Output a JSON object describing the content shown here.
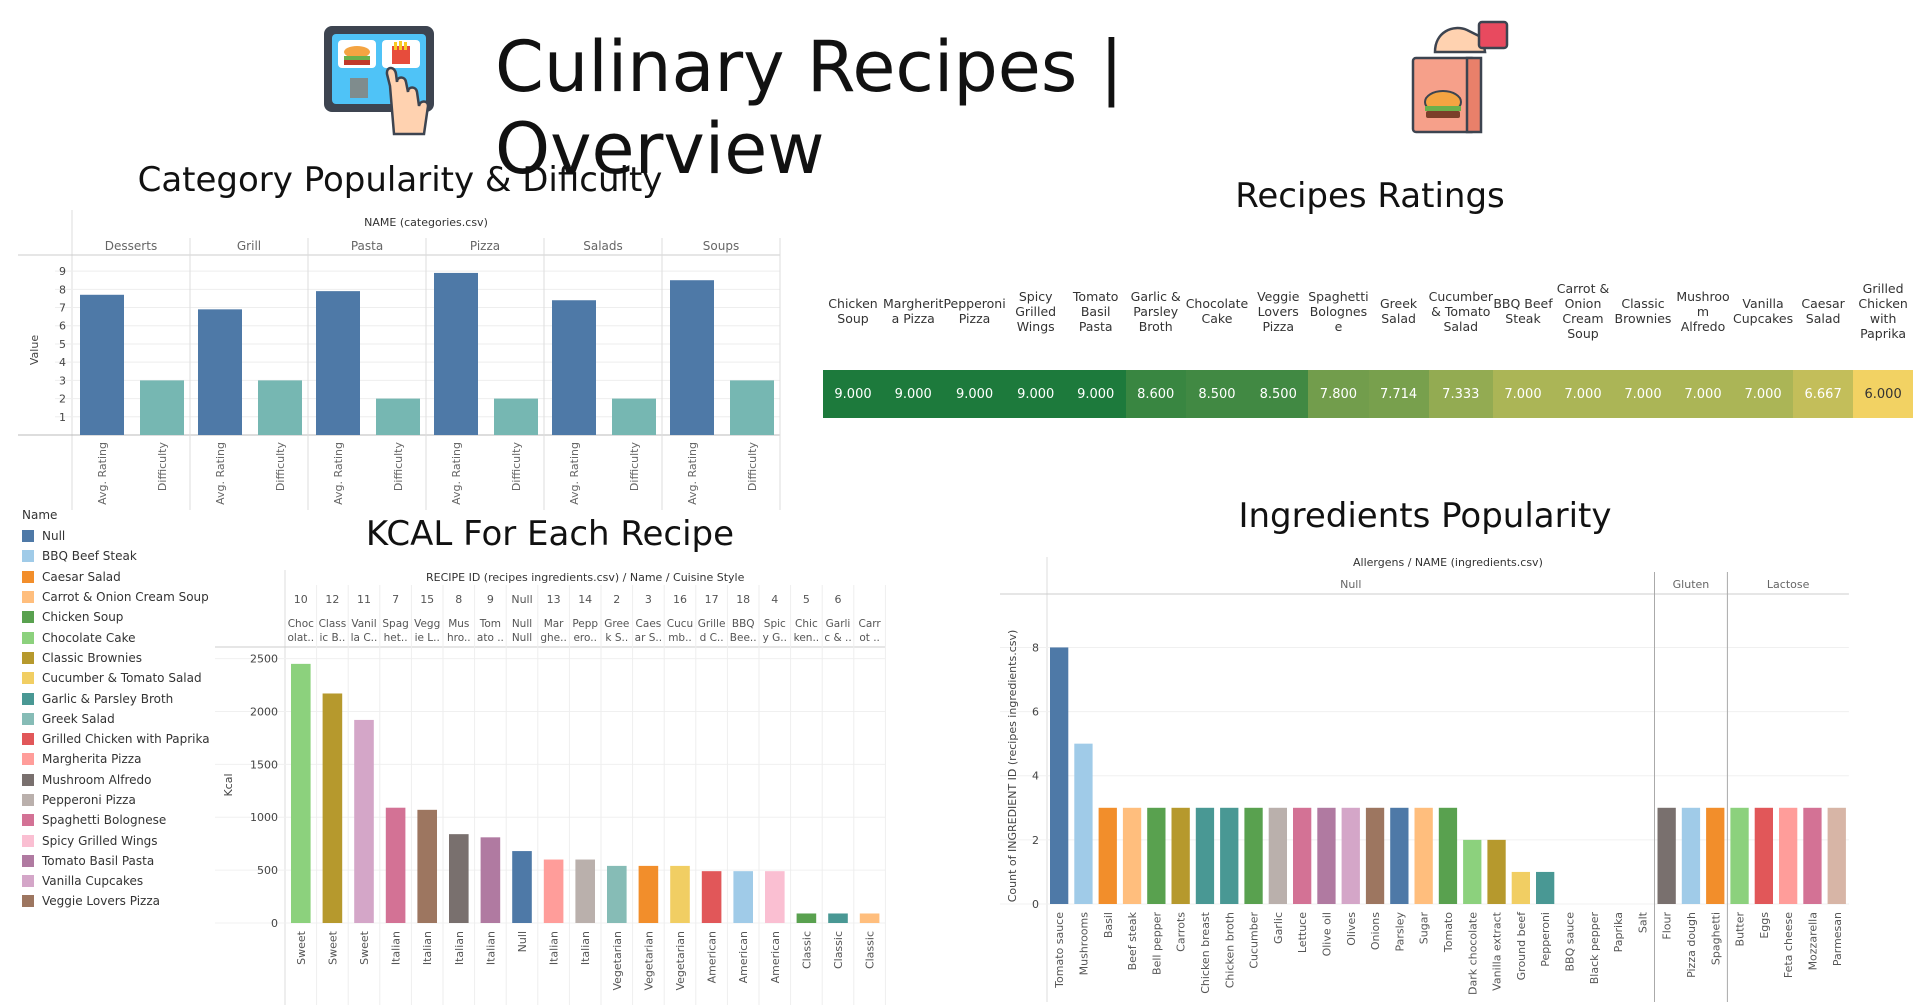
{
  "header": {
    "title": "Culinary Recipes | Overview",
    "left_icon": "tablet-food-ordering-icon",
    "right_icon": "takeaway-burger-bag-icon"
  },
  "sections": {
    "category": "Category Popularity & Dificulty",
    "ratings": "Recipes Ratings",
    "kcal": "KCAL For Each Recipe",
    "ingredients": "Ingredients Popularity"
  },
  "colors": {
    "rating_bar": "#4e79a7",
    "difficulty_bar": "#76b7b2",
    "heat_dark": "#1d7a3c",
    "heat_light": "#f2d263"
  },
  "legend": {
    "title": "Name",
    "items": [
      {
        "label": "Null",
        "color": "#4e79a7"
      },
      {
        "label": "BBQ Beef Steak",
        "color": "#a0cbe8"
      },
      {
        "label": "Caesar Salad",
        "color": "#f28e2b"
      },
      {
        "label": "Carrot & Onion Cream Soup",
        "color": "#ffbe7d"
      },
      {
        "label": "Chicken Soup",
        "color": "#59a14f"
      },
      {
        "label": "Chocolate Cake",
        "color": "#8cd17d"
      },
      {
        "label": "Classic Brownies",
        "color": "#b6992d"
      },
      {
        "label": "Cucumber & Tomato Salad",
        "color": "#f1ce63"
      },
      {
        "label": "Garlic & Parsley Broth",
        "color": "#499894"
      },
      {
        "label": "Greek Salad",
        "color": "#86bcb6"
      },
      {
        "label": "Grilled Chicken with Paprika",
        "color": "#e15759"
      },
      {
        "label": "Margherita Pizza",
        "color": "#ff9d9a"
      },
      {
        "label": "Mushroom Alfredo",
        "color": "#79706e"
      },
      {
        "label": "Pepperoni Pizza",
        "color": "#bab0ac"
      },
      {
        "label": "Spaghetti Bolognese",
        "color": "#d37295"
      },
      {
        "label": "Spicy Grilled Wings",
        "color": "#fabfd2"
      },
      {
        "label": "Tomato Basil Pasta",
        "color": "#b07aa1"
      },
      {
        "label": "Vanilla Cupcakes",
        "color": "#d4a6c8"
      },
      {
        "label": "Veggie Lovers Pizza",
        "color": "#9d7660"
      }
    ]
  },
  "chart_data": [
    {
      "type": "bar",
      "title": "Category Popularity & Dificulty",
      "header": "NAME (categories.csv)",
      "categories": [
        "Desserts",
        "Grill",
        "Pasta",
        "Pizza",
        "Salads",
        "Soups"
      ],
      "measures": [
        "Avg. Rating",
        "Difficulty"
      ],
      "series": [
        {
          "name": "Avg. Rating",
          "values": [
            7.7,
            6.9,
            7.9,
            8.9,
            7.4,
            8.5
          ]
        },
        {
          "name": "Difficulty",
          "values": [
            3,
            3,
            2,
            2,
            2,
            3
          ]
        }
      ],
      "ylabel": "Value",
      "yticks": [
        1,
        2,
        3,
        4,
        5,
        6,
        7,
        8,
        9
      ],
      "ylim": [
        0,
        9.5
      ]
    },
    {
      "type": "heatmap",
      "title": "Recipes Ratings",
      "columns": [
        "Chicken Soup",
        "Margherita Pizza",
        "Pepperoni Pizza",
        "Spicy Grilled Wings",
        "Tomato Basil Pasta",
        "Garlic & Parsley Broth",
        "Chocolate Cake",
        "Veggie Lovers Pizza",
        "Spaghetti Bolognese",
        "Greek Salad",
        "Cucumber & Tomato Salad",
        "BBQ Beef Steak",
        "Carrot & Onion Cream Soup",
        "Classic Brownies",
        "Mushroom Alfredo",
        "Vanilla Cupcakes",
        "Caesar Salad",
        "Grilled Chicken with Paprika"
      ],
      "header_lines": [
        [
          "Chicken",
          "Soup"
        ],
        [
          "Margherit",
          "a Pizza"
        ],
        [
          "Pepperoni",
          "Pizza"
        ],
        [
          "Spicy",
          "Grilled",
          "Wings"
        ],
        [
          "Tomato",
          "Basil",
          "Pasta"
        ],
        [
          "Garlic &",
          "Parsley",
          "Broth"
        ],
        [
          "Chocolate",
          "Cake"
        ],
        [
          "Veggie",
          "Lovers",
          "Pizza"
        ],
        [
          "Spaghetti",
          "Bolognes",
          "e"
        ],
        [
          "Greek",
          "Salad"
        ],
        [
          "Cucumber",
          "& Tomato",
          "Salad"
        ],
        [
          "BBQ Beef",
          "Steak"
        ],
        [
          "Carrot &",
          "Onion",
          "Cream",
          "Soup"
        ],
        [
          "Classic",
          "Brownies"
        ],
        [
          "Mushroo",
          "m Alfredo"
        ],
        [
          "Vanilla",
          "Cupcakes"
        ],
        [
          "Caesar",
          "Salad"
        ],
        [
          "Grilled",
          "Chicken",
          "with",
          "Paprika"
        ]
      ],
      "values": [
        9.0,
        9.0,
        9.0,
        9.0,
        9.0,
        8.6,
        8.5,
        8.5,
        7.8,
        7.714,
        7.333,
        7.0,
        7.0,
        7.0,
        7.0,
        7.0,
        6.667,
        6.0
      ],
      "labels": [
        "9.000",
        "9.000",
        "9.000",
        "9.000",
        "9.000",
        "8.600",
        "8.500",
        "8.500",
        "7.800",
        "7.714",
        "7.333",
        "7.000",
        "7.000",
        "7.000",
        "7.000",
        "7.000",
        "6.667",
        "6.000"
      ]
    },
    {
      "type": "bar",
      "title": "KCAL For Each Recipe",
      "header": "RECIPE ID (recipes ingredients.csv)  /  Name  /  Cuisine Style",
      "recipe_ids": [
        "10",
        "12",
        "11",
        "7",
        "15",
        "8",
        "9",
        "Null",
        "13",
        "14",
        "2",
        "3",
        "16",
        "17",
        "18",
        "4",
        "5",
        "6"
      ],
      "names_truncated": [
        [
          "Choc",
          "olat.."
        ],
        [
          "Class",
          "ic B.."
        ],
        [
          "Vanil",
          "la C.."
        ],
        [
          "Spag",
          "het.."
        ],
        [
          "Vegg",
          "ie L.."
        ],
        [
          "Mus",
          "hro.."
        ],
        [
          "Tom",
          "ato .."
        ],
        [
          "Null",
          "Null"
        ],
        [
          "Mar",
          "ghe.."
        ],
        [
          "Pepp",
          "ero.."
        ],
        [
          "Gree",
          "k S.."
        ],
        [
          "Caes",
          "ar S.."
        ],
        [
          "Cucu",
          "mb.."
        ],
        [
          "Grille",
          "d C.."
        ],
        [
          "BBQ",
          "Bee.."
        ],
        [
          "Spic",
          "y G.."
        ],
        [
          "Chic",
          "ken.."
        ],
        [
          "Garli",
          "c & .."
        ],
        [
          "Carr",
          "ot .."
        ]
      ],
      "names": [
        "Chocolate Cake",
        "Classic Brownies",
        "Vanilla Cupcakes",
        "Spaghetti Bolognese",
        "Veggie Lovers Pizza",
        "Mushroom Alfredo",
        "Tomato Basil Pasta",
        "Null",
        "Margherita Pizza",
        "Pepperoni Pizza",
        "Greek Salad",
        "Caesar Salad",
        "Cucumber & Tomato Salad",
        "Grilled Chicken with Paprika",
        "BBQ Beef Steak",
        "Spicy Grilled Wings",
        "Chicken Soup",
        "Garlic & Parsley Broth",
        "Carrot & Onion Cream Soup"
      ],
      "cuisine": [
        "Sweet",
        "Sweet",
        "Sweet",
        "Italian",
        "Italian",
        "Italian",
        "Italian",
        "Null",
        "Italian",
        "Italian",
        "Vegetarian",
        "Vegetarian",
        "Vegetarian",
        "American",
        "American",
        "American",
        "Classic",
        "Classic",
        "Classic"
      ],
      "values": [
        2450,
        2170,
        1920,
        1090,
        1070,
        840,
        810,
        680,
        600,
        600,
        540,
        540,
        540,
        490,
        490,
        490,
        90,
        90,
        90
      ],
      "ylabel": "Kcal",
      "yticks": [
        0,
        500,
        1000,
        1500,
        2000,
        2500
      ],
      "ylim": [
        0,
        2600
      ]
    },
    {
      "type": "bar",
      "title": "Ingredients Popularity",
      "header": "Allergens  /  NAME (ingredients.csv)",
      "groups": [
        {
          "name": "Null",
          "categories": [
            "Tomato sauce",
            "Mushrooms",
            "Basil",
            "Beef steak",
            "Bell pepper",
            "Carrots",
            "Chicken breast",
            "Chicken broth",
            "Cucumber",
            "Garlic",
            "Lettuce",
            "Olive oil",
            "Olives",
            "Onions",
            "Parsley",
            "Sugar",
            "Tomato",
            "Dark chocolate",
            "Vanilla extract",
            "Ground beef",
            "Pepperoni",
            "BBQ sauce",
            "Black pepper",
            "Paprika",
            "Salt"
          ],
          "values": [
            8,
            5,
            3,
            3,
            3,
            3,
            3,
            3,
            3,
            3,
            3,
            3,
            3,
            3,
            3,
            3,
            3,
            2,
            2,
            1,
            1,
            0,
            0,
            0,
            0
          ]
        },
        {
          "name": "Gluten",
          "categories": [
            "Flour",
            "Pizza dough",
            "Spaghetti"
          ],
          "values": [
            3,
            3,
            3
          ]
        },
        {
          "name": "Lactose",
          "categories": [
            "Butter",
            "Eggs",
            "Feta cheese",
            "Mozzarella",
            "Parmesan"
          ],
          "values": [
            3,
            3,
            3,
            3,
            3
          ]
        }
      ],
      "ylabel": "Count of INGREDIENT ID (recipes ingredients.csv)",
      "yticks": [
        0,
        2,
        4,
        6,
        8
      ],
      "ylim": [
        0,
        8.7
      ]
    }
  ]
}
